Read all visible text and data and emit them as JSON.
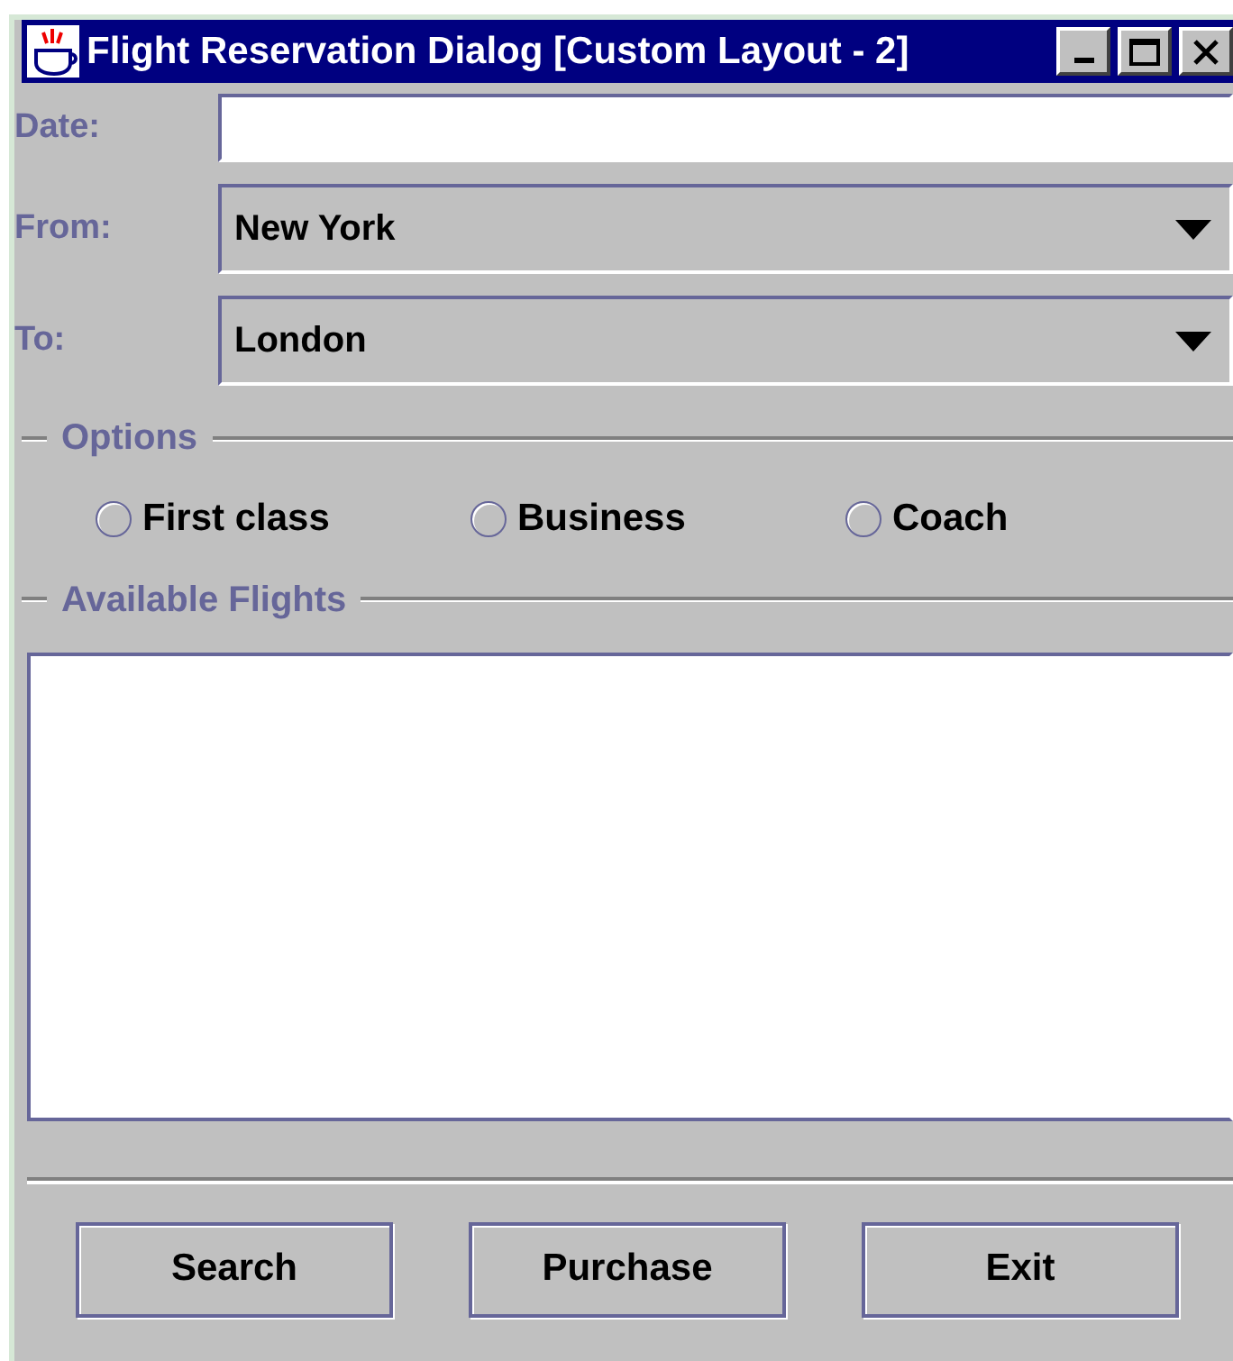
{
  "window": {
    "title": "Flight Reservation Dialog [Custom Layout - 2]"
  },
  "fields": [
    {
      "kind": "text",
      "label": "Date:"
    },
    {
      "kind": "combo",
      "label": "From:",
      "value": "New York"
    },
    {
      "kind": "combo",
      "label": "To:",
      "value": "London"
    }
  ],
  "options": {
    "title": "Options",
    "items": [
      {
        "label": "First class",
        "selected": false
      },
      {
        "label": "Business",
        "selected": false
      },
      {
        "label": "Coach",
        "selected": false
      }
    ]
  },
  "flights": {
    "title": "Available Flights"
  },
  "buttons": [
    "Search",
    "Purchase",
    "Exit"
  ]
}
